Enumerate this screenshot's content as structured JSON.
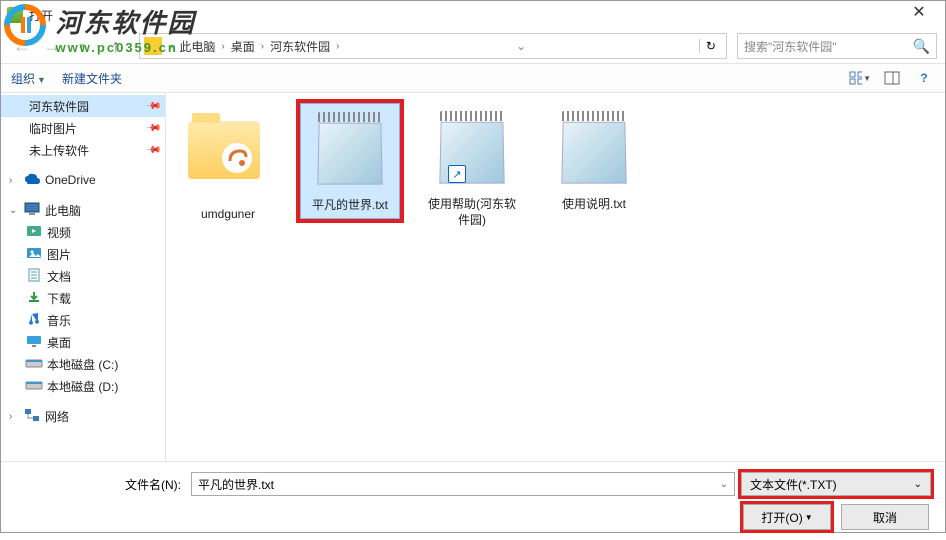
{
  "logo": {
    "cn": "河东软件园",
    "url": "www.pc0359.cn"
  },
  "titlebar": {
    "title": "打开"
  },
  "breadcrumb": {
    "items": [
      "此电脑",
      "桌面",
      "河东软件园"
    ]
  },
  "search": {
    "placeholder": "搜索\"河东软件园\""
  },
  "toolbar": {
    "organize": "组织",
    "new_folder": "新建文件夹"
  },
  "sidebar": {
    "items": [
      {
        "label": "河东软件园",
        "kind": "folder",
        "pinned": true,
        "selected": true
      },
      {
        "label": "临时图片",
        "kind": "folder",
        "pinned": true
      },
      {
        "label": "未上传软件",
        "kind": "folder",
        "pinned": true
      },
      {
        "spacer": true
      },
      {
        "label": "OneDrive",
        "kind": "onedrive",
        "root": true,
        "chev": ">"
      },
      {
        "spacer": true
      },
      {
        "label": "此电脑",
        "kind": "pc",
        "root": true,
        "chev": "v"
      },
      {
        "label": "视频",
        "kind": "videos"
      },
      {
        "label": "图片",
        "kind": "pictures"
      },
      {
        "label": "文档",
        "kind": "documents"
      },
      {
        "label": "下载",
        "kind": "downloads"
      },
      {
        "label": "音乐",
        "kind": "music"
      },
      {
        "label": "桌面",
        "kind": "desktop"
      },
      {
        "label": "本地磁盘 (C:)",
        "kind": "drive"
      },
      {
        "label": "本地磁盘 (D:)",
        "kind": "drive"
      },
      {
        "spacer": true
      },
      {
        "label": "网络",
        "kind": "network",
        "root": true,
        "chev": ">"
      }
    ]
  },
  "files": [
    {
      "label": "umdguner",
      "type": "folder"
    },
    {
      "label": "平凡的世界.txt",
      "type": "txt",
      "selected": true,
      "highlight": true
    },
    {
      "label": "使用帮助(河东软件园)",
      "type": "txt-shortcut"
    },
    {
      "label": "使用说明.txt",
      "type": "txt"
    }
  ],
  "bottom": {
    "filename_label": "文件名(N):",
    "filename_value": "平凡的世界.txt",
    "filter": "文本文件(*.TXT)",
    "open_btn": "打开(O)",
    "cancel_btn": "取消"
  }
}
